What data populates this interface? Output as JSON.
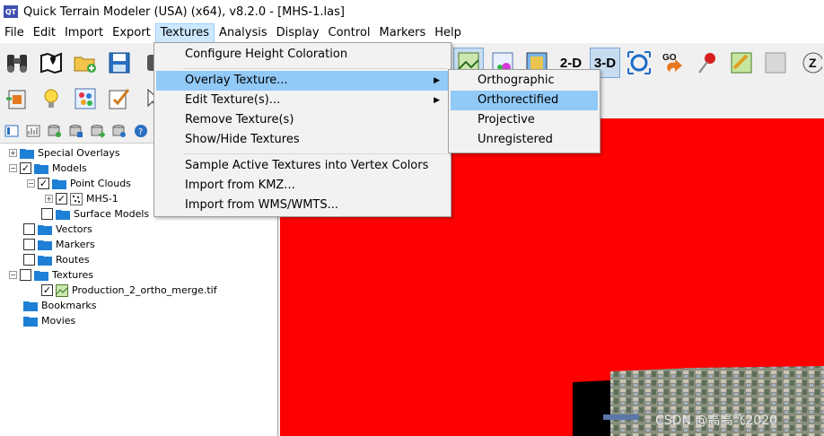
{
  "window": {
    "title": "Quick Terrain Modeler (USA) (x64), v8.2.0 - [MHS-1.las]",
    "app_icon_text": "QT"
  },
  "menubar": {
    "items": [
      {
        "label": "File"
      },
      {
        "label": "Edit"
      },
      {
        "label": "Import"
      },
      {
        "label": "Export"
      },
      {
        "label": "Textures"
      },
      {
        "label": "Analysis"
      },
      {
        "label": "Display"
      },
      {
        "label": "Control"
      },
      {
        "label": "Markers"
      },
      {
        "label": "Help"
      }
    ],
    "active": "Textures"
  },
  "toolbar": {
    "btn_2d": "2-D",
    "btn_3d": "3-D",
    "go_label": "GO",
    "z_label": "Z"
  },
  "textures_menu": {
    "items": [
      {
        "label": "Configure Height Coloration"
      },
      {
        "label": "Overlay Texture..."
      },
      {
        "label": "Edit Texture(s)..."
      },
      {
        "label": "Remove Texture(s)"
      },
      {
        "label": "Show/Hide Textures"
      },
      {
        "label": "Sample Active Textures into Vertex Colors"
      },
      {
        "label": "Import from KMZ..."
      },
      {
        "label": "Import from WMS/WMTS..."
      }
    ],
    "highlighted": "Overlay Texture..."
  },
  "overlay_submenu": {
    "items": [
      {
        "label": "Orthographic"
      },
      {
        "label": "Orthorectified"
      },
      {
        "label": "Projective"
      },
      {
        "label": "Unregistered"
      }
    ],
    "highlighted": "Orthorectified"
  },
  "tree": {
    "special_overlays": "Special Overlays",
    "models": "Models",
    "point_clouds": "Point Clouds",
    "mhs1": "MHS-1",
    "surface_models": "Surface Models",
    "vectors": "Vectors",
    "markers": "Markers",
    "routes": "Routes",
    "textures": "Textures",
    "texture_file": "Production_2_ortho_merge.tif",
    "bookmarks": "Bookmarks",
    "movies": "Movies"
  },
  "colors": {
    "viewport_bg": "#ff0000",
    "menu_highlight": "#91c9f7",
    "folder": "#1e7fd6"
  },
  "watermark": "CSDN @高高飞2020"
}
